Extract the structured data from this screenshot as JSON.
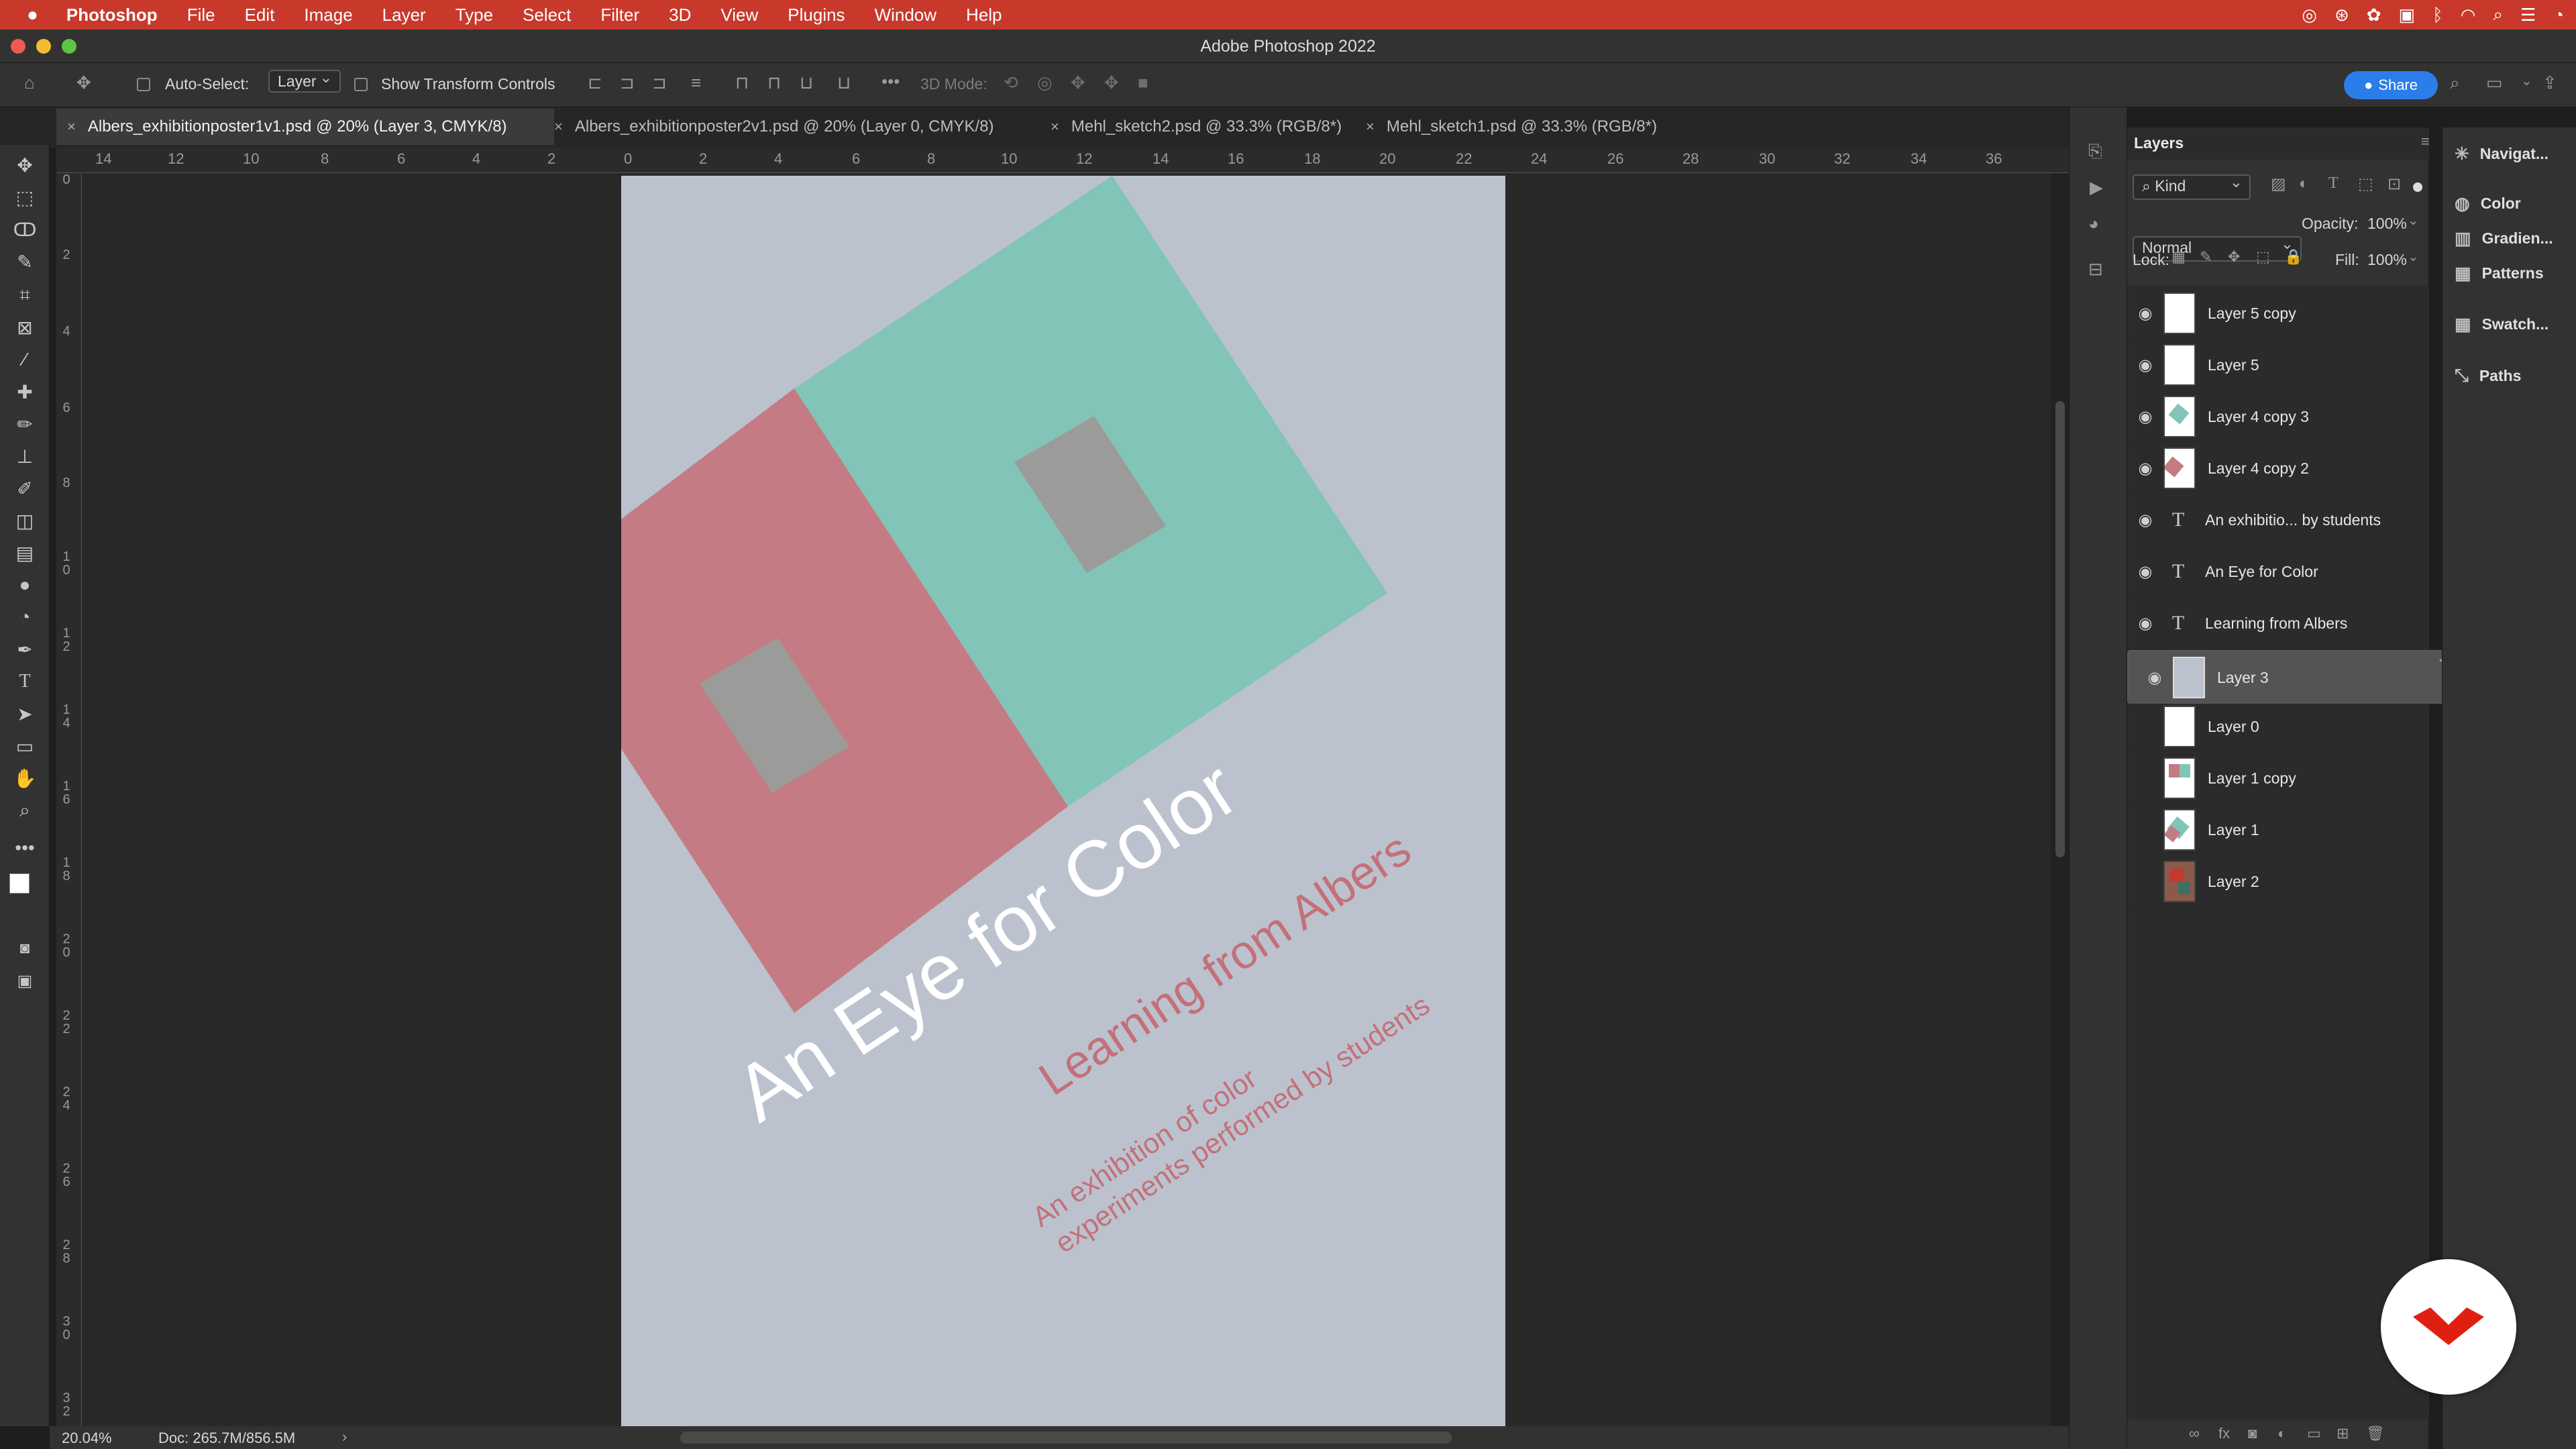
{
  "menubar": {
    "app": "Photoshop",
    "items": [
      "File",
      "Edit",
      "Image",
      "Layer",
      "Type",
      "Select",
      "Filter",
      "3D",
      "View",
      "Plugins",
      "Window",
      "Help"
    ]
  },
  "window": {
    "title": "Adobe Photoshop 2022"
  },
  "options": {
    "auto_select_label": "Auto-Select:",
    "auto_select_value": "Layer",
    "transform_label": "Show Transform Controls",
    "mode3d_label": "3D Mode:",
    "share_label": "Share"
  },
  "tabs": [
    {
      "label": "Albers_exhibitionposter1v1.psd @ 20% (Layer 3, CMYK/8)",
      "active": true
    },
    {
      "label": "Albers_exhibitionposter2v1.psd @ 20% (Layer 0, CMYK/8)",
      "active": false
    },
    {
      "label": "Mehl_sketch2.psd @ 33.3% (RGB/8*)",
      "active": false
    },
    {
      "label": "Mehl_sketch1.psd @ 33.3% (RGB/8*)",
      "active": false
    }
  ],
  "ruler": {
    "top": [
      "14",
      "12",
      "10",
      "8",
      "6",
      "4",
      "2",
      "0",
      "2",
      "4",
      "6",
      "8",
      "10",
      "12",
      "14",
      "16",
      "18",
      "20",
      "22",
      "24",
      "26",
      "28",
      "30",
      "32",
      "34",
      "36"
    ],
    "left": [
      "0",
      "2",
      "4",
      "6",
      "8",
      "10",
      "12",
      "14",
      "16",
      "18",
      "20",
      "22",
      "24",
      "26",
      "28",
      "30",
      "32"
    ]
  },
  "poster": {
    "title": "An Eye for Color",
    "subtitle": "Learning from Albers",
    "tagline_1": "An exhibition of color",
    "tagline_2": "experiments performed by students",
    "colors": {
      "background": "#bbc2cd",
      "teal": "#82c4b8",
      "red": "#c47b83",
      "grey": "#9b9c99",
      "title": "#ffffff",
      "accent": "#c4707a"
    }
  },
  "status": {
    "zoom": "20.04%",
    "doc": "Doc: 265.7M/856.5M"
  },
  "layers_panel": {
    "title": "Layers",
    "kind": "Kind",
    "blend_mode": "Normal",
    "opacity_label": "Opacity:",
    "opacity": "100%",
    "lock_label": "Lock:",
    "fill_label": "Fill:",
    "fill": "100%",
    "layers": [
      {
        "name": "Layer 5 copy",
        "type": "pixel",
        "visible": true,
        "selected": false
      },
      {
        "name": "Layer 5",
        "type": "pixel",
        "visible": true,
        "selected": false
      },
      {
        "name": "Layer 4 copy 3",
        "type": "pixel",
        "visible": true,
        "selected": false
      },
      {
        "name": "Layer 4 copy 2",
        "type": "pixel",
        "visible": true,
        "selected": false
      },
      {
        "name": "An exhibitio... by students",
        "type": "text",
        "visible": true,
        "selected": false
      },
      {
        "name": "An Eye for Color",
        "type": "text",
        "visible": true,
        "selected": false
      },
      {
        "name": "Learning from Albers",
        "type": "text",
        "visible": true,
        "selected": false
      },
      {
        "name": "Layer 3",
        "type": "pixel",
        "visible": true,
        "selected": true
      },
      {
        "name": "Layer 0",
        "type": "pixel",
        "visible": false,
        "selected": false
      },
      {
        "name": "Layer 1 copy",
        "type": "pixel",
        "visible": false,
        "selected": false
      },
      {
        "name": "Layer 1",
        "type": "pixel",
        "visible": false,
        "selected": false
      },
      {
        "name": "Layer 2",
        "type": "pixel",
        "visible": false,
        "selected": false
      }
    ]
  },
  "side_panels": [
    "Navigat...",
    "Color",
    "Gradien...",
    "Patterns",
    "Swatch...",
    "Paths"
  ]
}
